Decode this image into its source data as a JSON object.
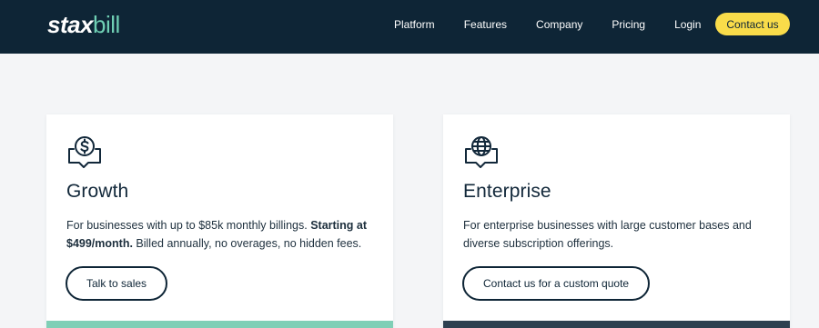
{
  "brand": {
    "part1": "stax",
    "part2": "bill"
  },
  "nav": {
    "links": [
      "Platform",
      "Features",
      "Company",
      "Pricing",
      "Login"
    ],
    "contact_label": "Contact us"
  },
  "colors": {
    "navbar": "#0e2536",
    "accent_yellow": "#f9dc4a",
    "accent_green": "#7fcfb6",
    "dark_strip": "#2d4050"
  },
  "cards": [
    {
      "icon": "dollar-chat-icon",
      "title": "Growth",
      "desc_start": "For businesses with up to $85k monthly billings. ",
      "desc_bold": "Starting at $499/month.",
      "desc_end": " Billed annually, no overages, no hidden fees.",
      "button_label": "Talk to sales"
    },
    {
      "icon": "globe-chat-icon",
      "title": "Enterprise",
      "desc": "For enterprise businesses with large customer bases and diverse subscription offerings.",
      "button_label": "Contact us for a custom quote"
    }
  ]
}
